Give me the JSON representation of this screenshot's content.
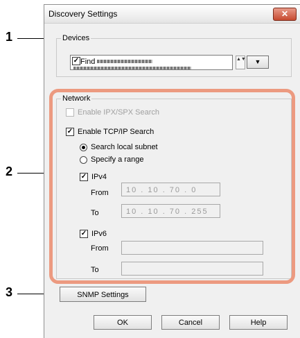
{
  "dialog": {
    "title": "Discovery Settings",
    "close_glyph": "✕"
  },
  "devices": {
    "legend": "Devices",
    "find_label": "Find",
    "find_checked": true,
    "spin_glyph": "▲▼",
    "dropdown_glyph": "▼"
  },
  "network": {
    "legend": "Network",
    "ipx_label": "Enable IPX/SPX Search",
    "ipx_checked": false,
    "tcpip_label": "Enable TCP/IP Search",
    "tcpip_checked": true,
    "radio_local": "Search local subnet",
    "radio_range": "Specify a range",
    "ipv4_label": "IPv4",
    "ipv4_from_label": "From",
    "ipv4_from_value": "10 . 10 . 70 . 0",
    "ipv4_to_label": "To",
    "ipv4_to_value": "10 . 10 . 70 . 255",
    "ipv6_label": "IPv6",
    "ipv6_from_label": "From",
    "ipv6_from_value": "",
    "ipv6_to_label": "To",
    "ipv6_to_value": ""
  },
  "buttons": {
    "snmp": "SNMP Settings",
    "ok": "OK",
    "cancel": "Cancel",
    "help": "Help"
  },
  "callouts": {
    "one": "1",
    "two": "2",
    "three": "3"
  },
  "colors": {
    "highlight": "#ec9a80",
    "close": "#c64a30"
  }
}
